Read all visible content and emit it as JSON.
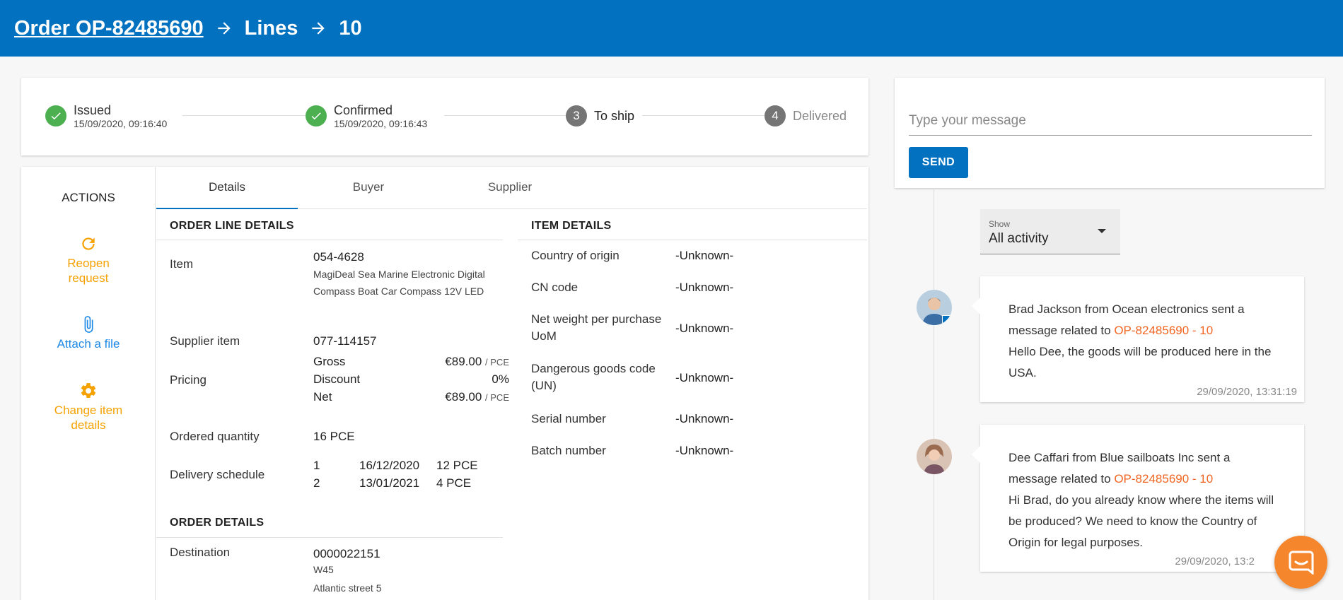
{
  "breadcrumb": {
    "order": "Order OP-82485690",
    "lines": "Lines",
    "line_no": "10"
  },
  "stepper": {
    "steps": [
      {
        "label": "Issued",
        "timestamp": "15/09/2020, 09:16:40",
        "state": "done"
      },
      {
        "label": "Confirmed",
        "timestamp": "15/09/2020, 09:16:43",
        "state": "done"
      },
      {
        "label": "To ship",
        "number": "3",
        "state": "active"
      },
      {
        "label": "Delivered",
        "number": "4",
        "state": "pending"
      }
    ]
  },
  "actions": {
    "title": "ACTIONS",
    "reopen": "Reopen request",
    "attach": "Attach a file",
    "change": "Change item details"
  },
  "tabs": [
    "Details",
    "Buyer",
    "Supplier"
  ],
  "order_line": {
    "title": "ORDER LINE DETAILS",
    "item_label": "Item",
    "item_code": "054-4628",
    "item_desc": "MagiDeal Sea Marine Electronic Digital Compass Boat Car Compass 12V LED",
    "supplier_item_label": "Supplier item",
    "supplier_item": "077-114157",
    "pricing_label": "Pricing",
    "pricing": [
      {
        "label": "Gross",
        "value": "€89.00",
        "unit": "/ PCE"
      },
      {
        "label": "Discount",
        "value": "0%",
        "unit": ""
      },
      {
        "label": "Net",
        "value": "€89.00",
        "unit": "/ PCE"
      }
    ],
    "qty_label": "Ordered quantity",
    "qty": "16 PCE",
    "schedule_label": "Delivery schedule",
    "schedule": [
      {
        "no": "1",
        "date": "16/12/2020",
        "qty": "12 PCE"
      },
      {
        "no": "2",
        "date": "13/01/2021",
        "qty": "4 PCE"
      }
    ]
  },
  "order_details": {
    "title": "ORDER DETAILS",
    "dest_label": "Destination",
    "dest_code": "0000022151",
    "dest_line1": "W45",
    "dest_line2": "Atlantic street 5"
  },
  "item_details": {
    "title": "ITEM DETAILS",
    "rows": [
      {
        "label": "Country of origin",
        "value": "-Unknown-"
      },
      {
        "label": "CN code",
        "value": "-Unknown-"
      },
      {
        "label": "Net weight per purchase UoM",
        "value": "-Unknown-"
      },
      {
        "label": "Dangerous goods code (UN)",
        "value": "-Unknown-"
      },
      {
        "label": "Serial number",
        "value": "-Unknown-"
      },
      {
        "label": "Batch number",
        "value": "-Unknown-"
      }
    ]
  },
  "message_box": {
    "placeholder": "Type your message",
    "send": "SEND"
  },
  "activity_filter": {
    "label": "Show",
    "value": "All activity"
  },
  "messages": [
    {
      "header": "Brad Jackson from Ocean electronics sent a message related to",
      "ref": "OP-82485690 - 10",
      "body": "Hello Dee, the goods will be produced here in the USA.",
      "timestamp": "29/09/2020, 13:31:19"
    },
    {
      "header": "Dee Caffari from Blue sailboats Inc sent a message related to",
      "ref": "OP-82485690 - 10",
      "body": "Hi Brad, do you already know where the items will be produced? We need to know the Country of Origin for legal purposes.",
      "timestamp": "29/09/2020, 13:2"
    }
  ],
  "colors": {
    "brand_blue": "#0171c0",
    "action_orange": "#f5a100",
    "reference_orange": "#f26522",
    "success_green": "#4caf50"
  }
}
